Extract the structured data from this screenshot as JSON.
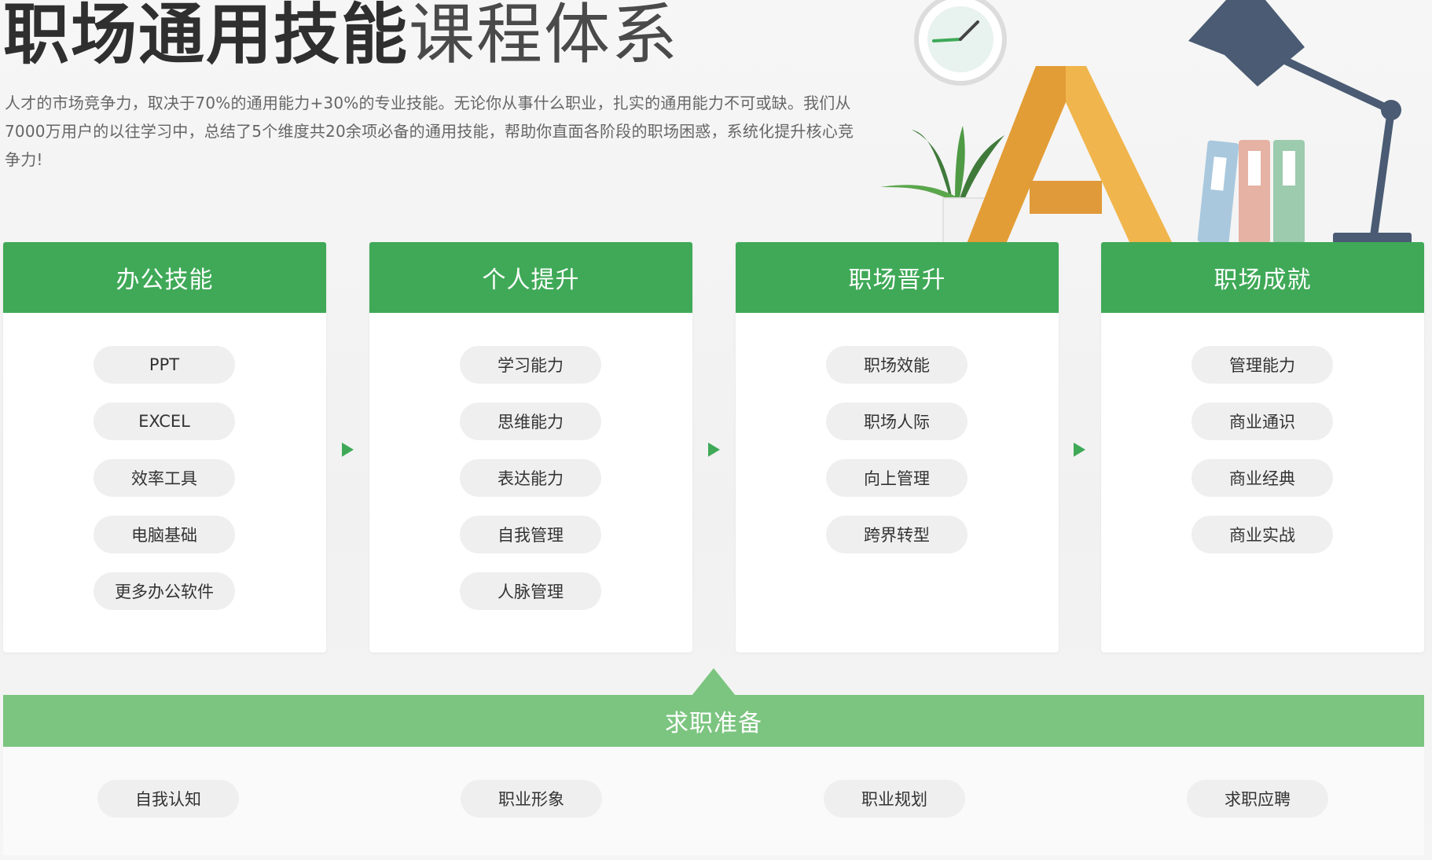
{
  "header": {
    "title_bold": "职场通用技能",
    "title_light": "课程体系",
    "intro": "人才的市场竞争力，取决于70%的通用能力+30%的专业技能。无论你从事什么职业，扎实的通用能力不可或缺。我们从7000万用户的以往学习中，总结了5个维度共20余项必备的通用技能，帮助你直面各阶段的职场困惑，系统化提升核心竞争力!"
  },
  "columns": [
    {
      "title": "办公技能",
      "items": [
        "PPT",
        "EXCEL",
        "效率工具",
        "电脑基础",
        "更多办公软件"
      ]
    },
    {
      "title": "个人提升",
      "items": [
        "学习能力",
        "思维能力",
        "表达能力",
        "自我管理",
        "人脉管理"
      ]
    },
    {
      "title": "职场晋升",
      "items": [
        "职场效能",
        "职场人际",
        "向上管理",
        "跨界转型"
      ]
    },
    {
      "title": "职场成就",
      "items": [
        "管理能力",
        "商业通识",
        "商业经典",
        "商业实战"
      ]
    }
  ],
  "foundation": {
    "title": "求职准备",
    "items": [
      "自我认知",
      "职业形象",
      "职业规划",
      "求职应聘"
    ]
  },
  "colors": {
    "primary_green": "#3fa957",
    "light_green": "#7cc580",
    "pill_bg": "#efefef"
  },
  "icons": [
    "arrow-right-icon",
    "clock-icon",
    "plant-icon",
    "letter-a-icon",
    "binders-icon",
    "desk-lamp-icon"
  ]
}
